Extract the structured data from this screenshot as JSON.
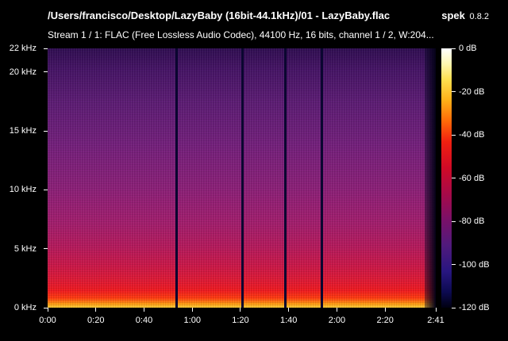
{
  "header": {
    "file_path": "/Users/francisco/Desktop/LazyBaby (16bit-44.1kHz)/01 - LazyBaby.flac",
    "app_name": "spek",
    "app_version": "0.8.2",
    "stream_info": "Stream 1 / 1: FLAC (Free Lossless Audio Codec), 44100 Hz, 16 bits, channel 1 / 2, W:204..."
  },
  "frequency_axis": {
    "max_khz": 22,
    "ticks": [
      {
        "label": "22 kHz",
        "khz": 22
      },
      {
        "label": "20 kHz",
        "khz": 20
      },
      {
        "label": "15 kHz",
        "khz": 15
      },
      {
        "label": "10 kHz",
        "khz": 10
      },
      {
        "label": "5 kHz",
        "khz": 5
      },
      {
        "label": "0 kHz",
        "khz": 0
      }
    ]
  },
  "time_axis": {
    "duration_s": 161,
    "ticks": [
      {
        "label": "0:00",
        "s": 0
      },
      {
        "label": "0:20",
        "s": 20
      },
      {
        "label": "0:40",
        "s": 40
      },
      {
        "label": "1:00",
        "s": 60
      },
      {
        "label": "1:20",
        "s": 80
      },
      {
        "label": "1:40",
        "s": 100
      },
      {
        "label": "2:00",
        "s": 120
      },
      {
        "label": "2:20",
        "s": 140
      },
      {
        "label": "2:41",
        "s": 161
      }
    ]
  },
  "level_legend": {
    "min_db": -120,
    "max_db": 0,
    "ticks": [
      {
        "label": "0 dB",
        "db": 0
      },
      {
        "label": "-20 dB",
        "db": -20
      },
      {
        "label": "-40 dB",
        "db": -40
      },
      {
        "label": "-60 dB",
        "db": -60
      },
      {
        "label": "-80 dB",
        "db": -80
      },
      {
        "label": "-100 dB",
        "db": -100
      },
      {
        "label": "-120 dB",
        "db": -120
      }
    ]
  },
  "quiet_moments_s": [
    53.5,
    80.5,
    98.5,
    113.5
  ]
}
